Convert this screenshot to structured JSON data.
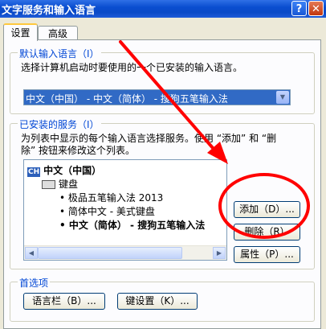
{
  "window": {
    "title": "文字服务和输入语言",
    "help_glyph": "?",
    "close_glyph": "✕"
  },
  "tabs": [
    {
      "label": "设置",
      "active": true
    },
    {
      "label": "高级",
      "active": false
    }
  ],
  "default_language": {
    "legend": "默认输入语言（I）",
    "description": "选择计算机启动时要使用的一个已安装的输入语言。",
    "selected": "中文（中国） - 中文（简体） - 搜狗五笔输入法",
    "dropdown_glyph": "▼"
  },
  "installed_services": {
    "legend": "已安装的服务（I）",
    "description_line1": "为列表中显示的每个输入语言选择服务。使用 “添加” 和 “删",
    "description_line2": "除” 按钮来修改这个列表。",
    "tree": {
      "language_code": "CH",
      "language": "中文（中国）",
      "category": "键盘",
      "items": [
        "极品五笔输入法 2013",
        "简体中文 - 美式键盘",
        "中文（简体） - 搜狗五笔输入法"
      ]
    },
    "buttons": {
      "add": "添加（D）...",
      "remove": "删除（R）",
      "properties": "属性（P）..."
    },
    "scroll_left": "◀",
    "scroll_right": "▶"
  },
  "preferences": {
    "legend": "首选项",
    "language_bar_button": "语言栏（B）...",
    "key_settings_button": "键设置（K）..."
  },
  "colors": {
    "title_bar": "#0a49c7",
    "selection": "#316ac5",
    "annotation_red": "#ff0000"
  }
}
